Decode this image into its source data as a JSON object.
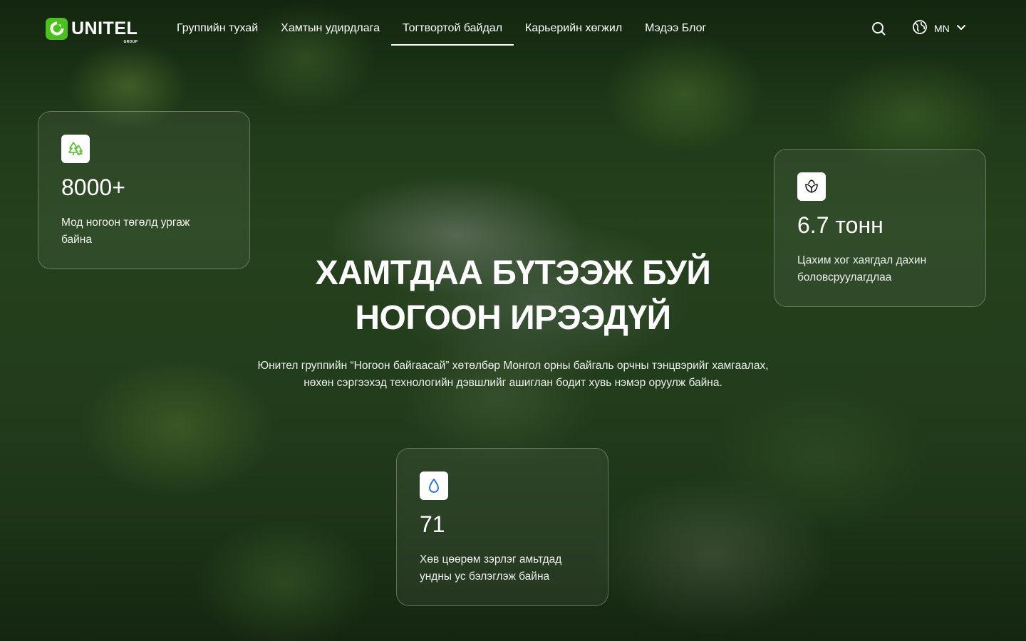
{
  "header": {
    "logo_text": "UNITEL",
    "logo_sub": "GROUP",
    "nav": [
      {
        "label": "Группийн тухай"
      },
      {
        "label": "Хамтын удирдлага"
      },
      {
        "label": "Тогтвортой байдал",
        "active": true
      },
      {
        "label": "Карьерийн хөгжил"
      },
      {
        "label": "Мэдээ Блог"
      }
    ],
    "search_icon": "search-icon",
    "language": {
      "icon": "globe-icon",
      "code": "MN",
      "chevron": "chevron-down-icon"
    }
  },
  "hero": {
    "title_line1": "ХАМТДАА БҮТЭЭЖ БУЙ",
    "title_line2": "НОГООН ИРЭЭДҮЙ",
    "description_line1": "Юнител группийн “Ногоон байгаасай” хөтөлбөр Монгол орны байгаль орчны тэнцвэрийг хамгаалах,",
    "description_line2": "нөхөн сэргээхэд технологийн дэвшлийг ашиглан бодит хувь нэмэр оруулж байна."
  },
  "stats": [
    {
      "icon": "trees-icon",
      "icon_color": "#4cc11e",
      "value": "8000+",
      "desc_line1": "Мод ногоон төгөлд ургаж",
      "desc_line2": "байна"
    },
    {
      "icon": "leaf-icon",
      "icon_color": "#1a1a1a",
      "value": "6.7 тонн",
      "desc_line1": "Цахим хог хаягдал дахин",
      "desc_line2": "боловсруулагдлаа"
    },
    {
      "icon": "water-drop-icon",
      "icon_color": "#1e6be6",
      "value": "71",
      "desc_line1": "Хөв цөөрөм зэрлэг амьтдад",
      "desc_line2": "ундны ус бэлэглэж байна"
    }
  ],
  "colors": {
    "brand_green": "#4cc11e"
  }
}
